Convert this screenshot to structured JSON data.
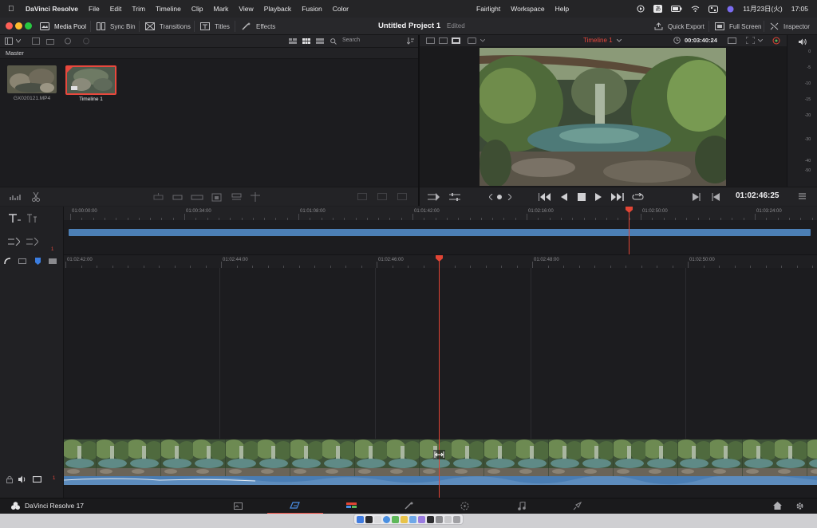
{
  "menubar": {
    "app_name": "DaVinci Resolve",
    "items": [
      "File",
      "Edit",
      "Trim",
      "Timeline",
      "Clip",
      "Mark",
      "View",
      "Playback",
      "Fusion",
      "Color",
      "Fairlight",
      "Workspace",
      "Help"
    ],
    "status": {
      "ime": "あ",
      "date": "11月23日(火)",
      "time": "17:05"
    }
  },
  "titlebar": {
    "tabs": {
      "media_pool": "Media Pool",
      "sync_bin": "Sync Bin",
      "transitions": "Transitions",
      "titles": "Titles",
      "effects": "Effects"
    },
    "project_title": "Untitled Project 1",
    "project_status": "Edited",
    "right": {
      "quick_export": "Quick Export",
      "full_screen": "Full Screen",
      "inspector": "Inspector"
    }
  },
  "media_pool": {
    "search_label": "Search",
    "bin": "Master",
    "clips": [
      {
        "name": "GX020121.MP4",
        "selected": false
      },
      {
        "name": "Timeline 1",
        "selected": true
      }
    ]
  },
  "viewer": {
    "timeline_name": "Timeline 1",
    "duration": "00:03:40:24",
    "timecode": "01:02:46:25"
  },
  "meter_labels": [
    "0",
    "-5",
    "-10",
    "-15",
    "-20",
    "-30",
    "-40",
    "-50"
  ],
  "upper_timeline": {
    "ruler": [
      "01:00:00:00",
      "01:00:34:00",
      "01:01:08:00",
      "01:01:42:00",
      "01:02:16:00",
      "01:02:50:00",
      "01:03:24:00"
    ],
    "track_number": "1"
  },
  "lower_timeline": {
    "ruler": [
      "01:02:42:00",
      "01:02:44:00",
      "01:02:46:00",
      "01:02:48:00",
      "01:02:50:00"
    ],
    "track_number": "1"
  },
  "pagebar": {
    "brand": "DaVinci Resolve 17",
    "active_page": "cut"
  },
  "colors": {
    "playhead": "#e24535",
    "clip_blue": "#4c7fb5",
    "accent_red": "#e8483d"
  }
}
